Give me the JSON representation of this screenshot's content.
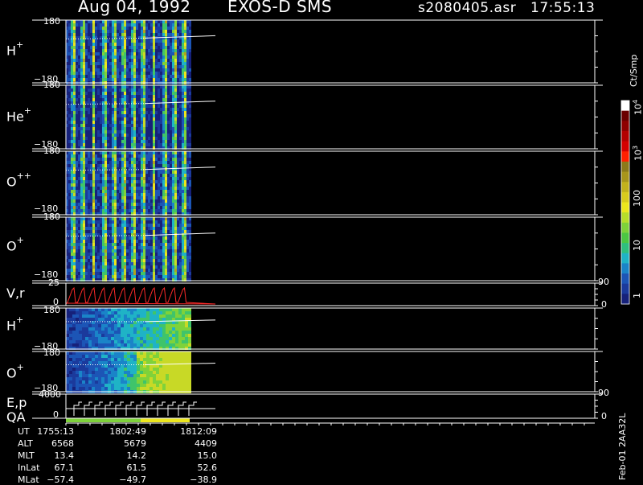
{
  "header": {
    "date": "Aug 04, 1992",
    "instrument": "EXOS-D SMS",
    "file": "s2080405.asr",
    "time": "17:55:13"
  },
  "panels": [
    {
      "species": "H",
      "charge": "+",
      "ymax": "180",
      "ymin": "−180"
    },
    {
      "species": "He",
      "charge": "+",
      "ymax": "180",
      "ymin": "−180"
    },
    {
      "species": "O",
      "charge": "++",
      "ymax": "180",
      "ymin": "−180"
    },
    {
      "species": "O",
      "charge": "+",
      "ymax": "180",
      "ymin": "−180"
    }
  ],
  "vr_panel": {
    "label": "V,r",
    "ymax": "25",
    "ymin": "0",
    "right_top": "90",
    "right_bottom": "0"
  },
  "lower_panels": [
    {
      "species": "H",
      "charge": "+",
      "ymax": "180",
      "ymin": "−180"
    },
    {
      "species": "O",
      "charge": "+",
      "ymax": "180",
      "ymin": "−180"
    }
  ],
  "ep_panel": {
    "label": "E,p",
    "ymax": "4000",
    "ymin": "0",
    "right_top": "90",
    "right_bottom": "0"
  },
  "qa_label": "QA",
  "colorbar": {
    "unit": "Ct/Smp",
    "labels": [
      "1",
      "10",
      "100",
      "10",
      "10"
    ],
    "exponents": [
      "",
      "",
      "",
      "3",
      "4"
    ]
  },
  "ephemeris": {
    "rows": [
      {
        "name": "UT",
        "values": [
          "1755:13",
          "1802:49",
          "1812:09"
        ]
      },
      {
        "name": "ALT",
        "values": [
          "6568",
          "5679",
          "4409"
        ]
      },
      {
        "name": "MLT",
        "values": [
          "13.4",
          "14.2",
          "15.0"
        ]
      },
      {
        "name": "InLat",
        "values": [
          "67.1",
          "61.5",
          "52.6"
        ]
      },
      {
        "name": "MLat",
        "values": [
          "−57.4",
          "−49.7",
          "−38.9"
        ]
      }
    ]
  },
  "side_text": "Feb-01 2AA32L",
  "colors": {
    "background": "#000000",
    "axis": "#ffffff",
    "vr_trace": "#ff2a2a"
  },
  "chart_data": {
    "type": "heatmap",
    "title": "Aug 04, 1992   EXOS-D SMS",
    "xlabel": "UT",
    "x_ticks": [
      "1755:13",
      "1802:49",
      "1812:09"
    ],
    "panels": [
      "H+",
      "He+",
      "O++",
      "O+",
      "V,r",
      "H+",
      "O+",
      "E,p",
      "QA"
    ],
    "ylim_angle": [
      -180,
      180
    ],
    "colorbar_scale": "log",
    "colorbar_range": [
      1,
      10000
    ],
    "colorbar_unit": "Ct/Smp"
  }
}
